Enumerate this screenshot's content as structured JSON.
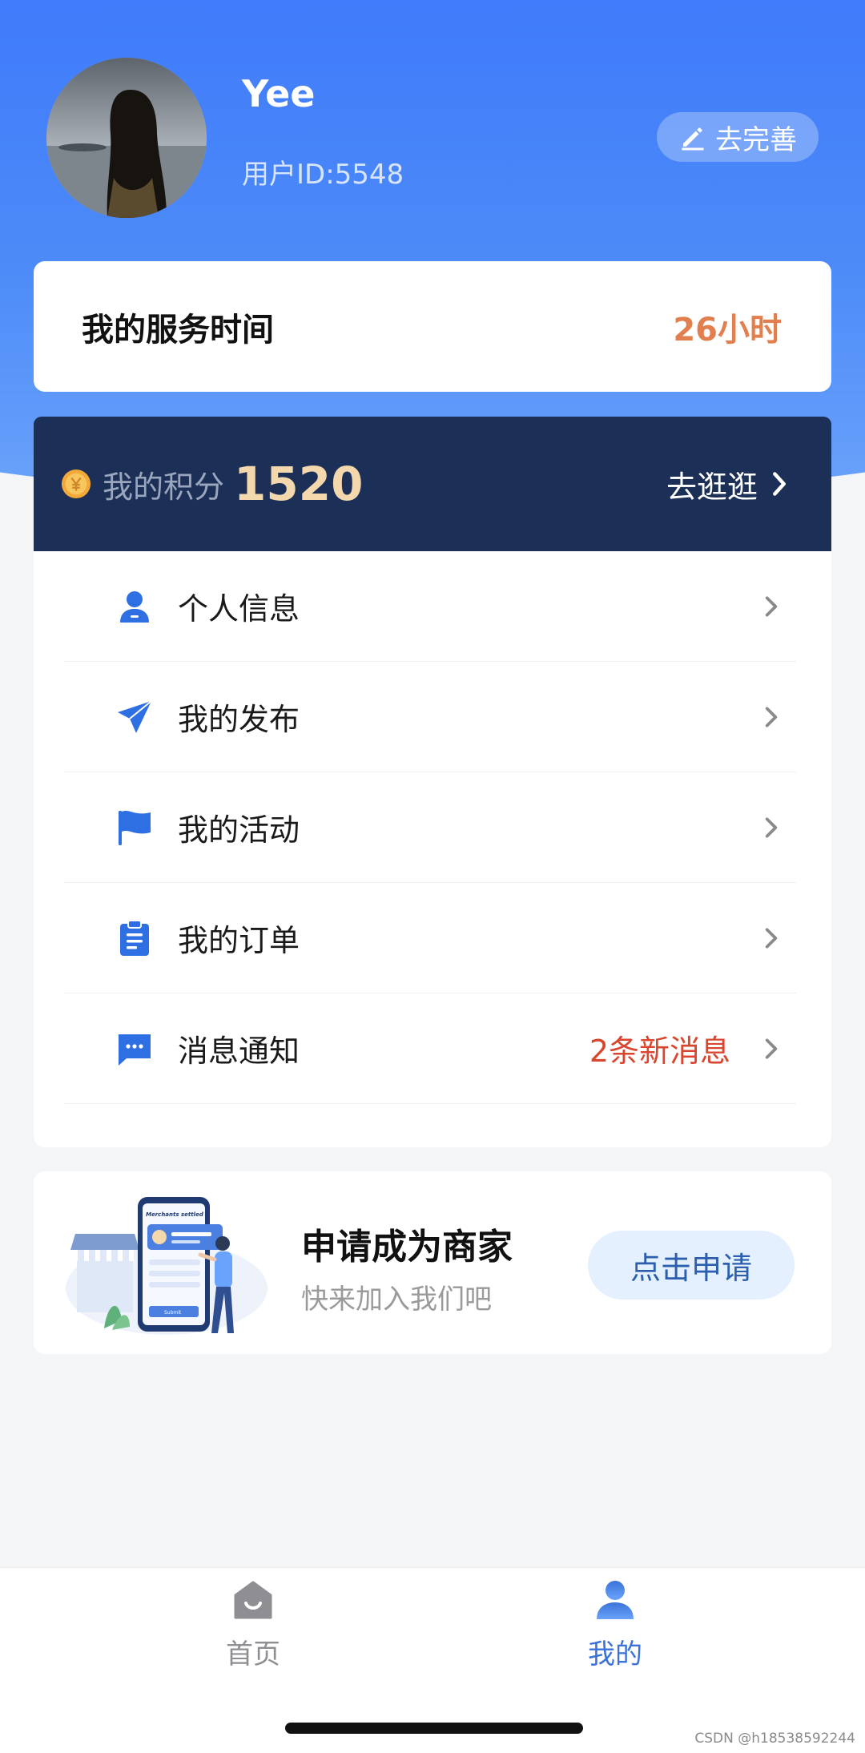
{
  "profile": {
    "username": "Yee",
    "user_id": "用户ID:5548",
    "edit_label": "去完善"
  },
  "service": {
    "label": "我的服务时间",
    "value": "26小时"
  },
  "points": {
    "label": "我的积分",
    "value": "1520",
    "go_label": "去逛逛"
  },
  "menu": {
    "items": [
      {
        "label": "个人信息",
        "icon": "person-icon",
        "badge": ""
      },
      {
        "label": "我的发布",
        "icon": "paper-plane-icon",
        "badge": ""
      },
      {
        "label": "我的活动",
        "icon": "flag-icon",
        "badge": ""
      },
      {
        "label": "我的订单",
        "icon": "clipboard-icon",
        "badge": ""
      },
      {
        "label": "消息通知",
        "icon": "chat-bubble-icon",
        "badge": "2条新消息"
      }
    ]
  },
  "merchant": {
    "title": "申请成为商家",
    "subtitle": "快来加入我们吧",
    "button_label": "点击申请",
    "illustration_text": "Merchants settled",
    "illustration_button": "Submit"
  },
  "tabbar": {
    "items": [
      {
        "label": "首页",
        "icon": "home-icon",
        "active": false
      },
      {
        "label": "我的",
        "icon": "user-icon",
        "active": true
      }
    ]
  },
  "watermark": "CSDN @h18538592244",
  "colors": {
    "primary": "#3f7bfa",
    "points_bg": "#1c3057",
    "points_value": "#f4d8ad",
    "service_value": "#e27f4e",
    "badge": "#d9452f",
    "icon_blue": "#2f6fe4"
  }
}
